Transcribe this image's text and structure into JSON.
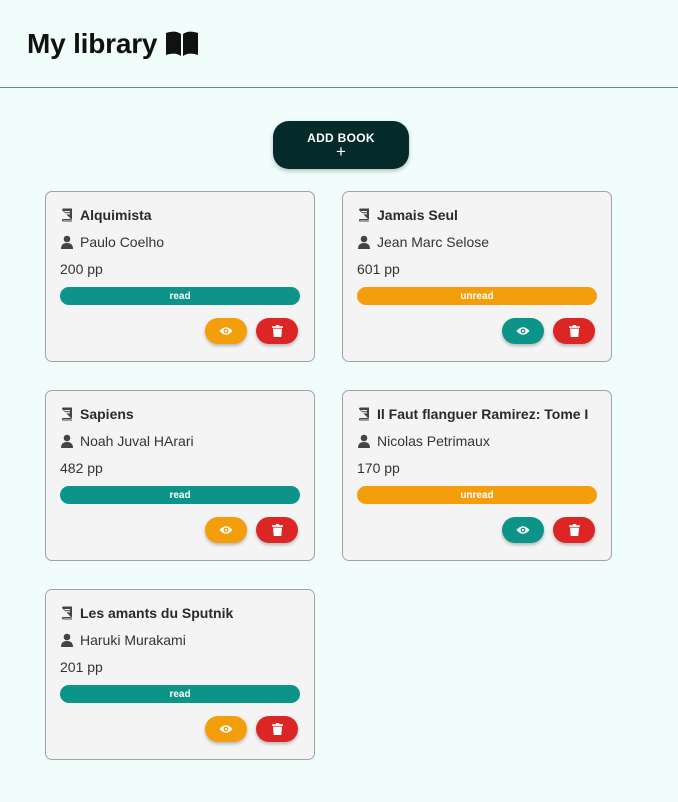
{
  "header": {
    "title": "My library",
    "icon": "book-open-icon"
  },
  "add_button": {
    "label": "ADD BOOK",
    "plus": "+"
  },
  "books": [
    {
      "title": "Alquimista",
      "author": "Paulo Coelho",
      "pages": "200 pp",
      "status": "read"
    },
    {
      "title": "Jamais Seul",
      "author": "Jean Marc Selose",
      "pages": "601 pp",
      "status": "unread"
    },
    {
      "title": "Sapiens",
      "author": "Noah Juval HArari",
      "pages": "482 pp",
      "status": "read"
    },
    {
      "title": "Il Faut flanguer Ramirez: Tome I",
      "author": "Nicolas Petrimaux",
      "pages": "170 pp",
      "status": "unread"
    },
    {
      "title": "Les amants du Sputnik",
      "author": "Haruki Murakami",
      "pages": "201 pp",
      "status": "read"
    }
  ],
  "colors": {
    "background": "#f0fdfa",
    "add_button": "#042a2b",
    "read": "#0d9488",
    "unread": "#f59e0b",
    "delete": "#dc2626"
  }
}
